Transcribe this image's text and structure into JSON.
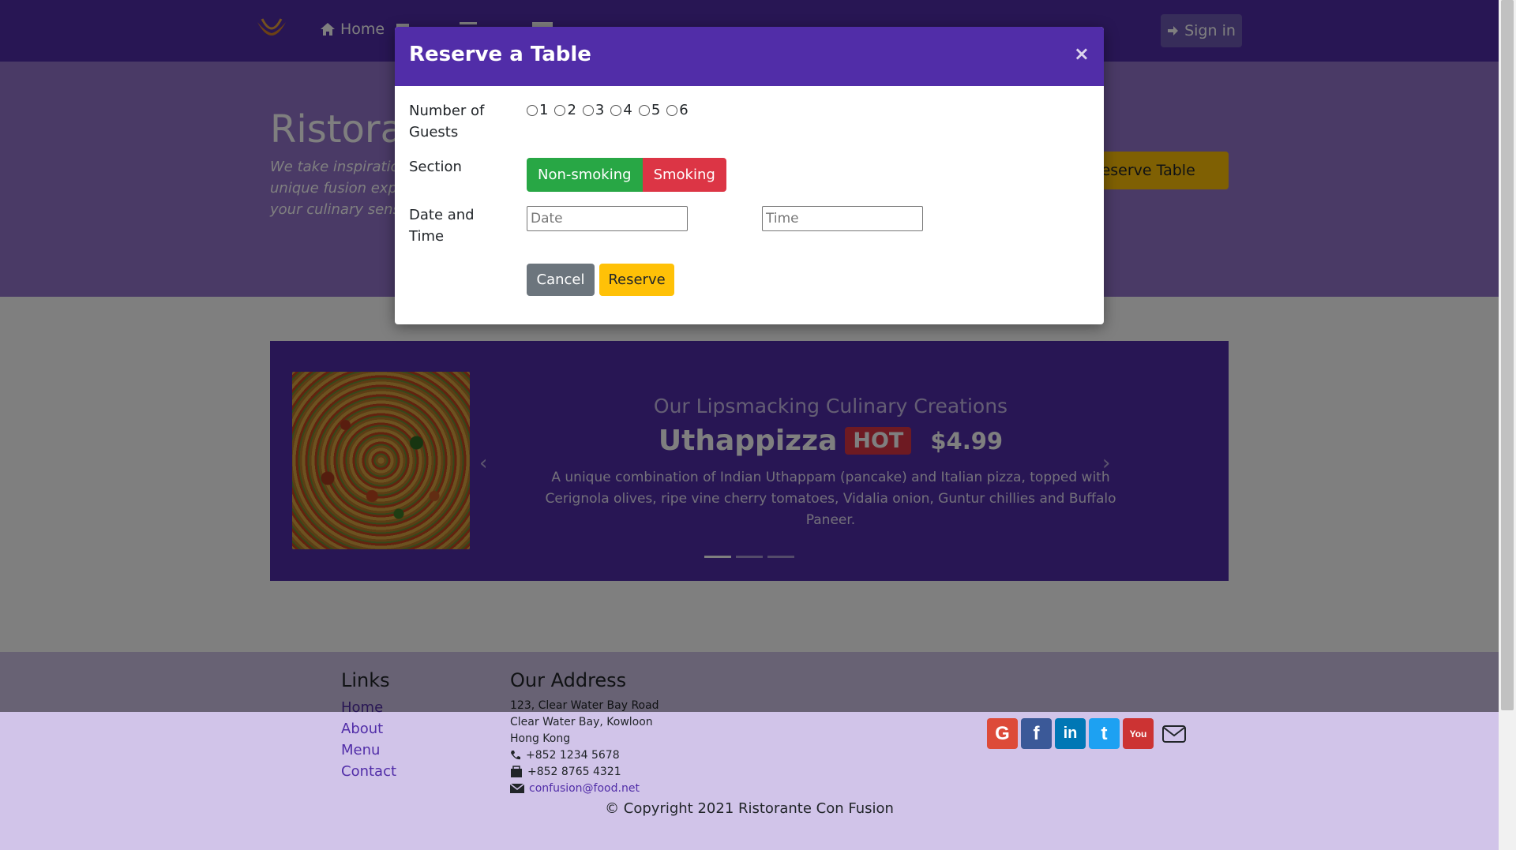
{
  "navbar": {
    "items": [
      {
        "label": "Home",
        "icon": "home-icon"
      },
      {
        "label": "",
        "icon": "info-icon"
      },
      {
        "label": "",
        "icon": "list-icon"
      },
      {
        "label": "",
        "icon": "address-card-icon"
      }
    ],
    "sign_in": "Sign in"
  },
  "jumbotron": {
    "title": "Ristorante con Fusion",
    "tagline": "We take inspiration from the World's best cuisines, and create a unique fusion experience. Our lipsmacking creations will tickle your culinary senses!",
    "reserve_button": "Reserve Table"
  },
  "carousel": {
    "subtitle": "Our Lipsmacking Culinary Creations",
    "dish_name": "Uthappizza",
    "badge": "HOT",
    "price": "$4.99",
    "description": "A unique combination of Indian Uthappam (pancake) and Italian pizza, topped with Cerignola olives, ripe vine cherry tomatoes, Vidalia onion, Guntur chillies and Buffalo Paneer.",
    "prev": "‹",
    "next": "›"
  },
  "footer": {
    "links_title": "Links",
    "links": [
      "Home",
      "About",
      "Menu",
      "Contact"
    ],
    "address_title": "Our Address",
    "address_lines": [
      "123, Clear Water Bay Road",
      "Clear Water Bay, Kowloon",
      "Hong Kong"
    ],
    "phone": "+852 1234 5678",
    "fax": "+852 8765 4321",
    "email": "confusion@food.net",
    "copyright": "© Copyright 2021 Ristorante Con Fusion",
    "social": [
      {
        "label": "G",
        "color": "#dd4b39",
        "icon": "google-plus-icon"
      },
      {
        "label": "f",
        "color": "#3b5998",
        "icon": "facebook-icon"
      },
      {
        "label": "in",
        "color": "#0077b5",
        "icon": "linkedin-icon"
      },
      {
        "label": "t",
        "color": "#1da1f2",
        "icon": "twitter-icon"
      },
      {
        "label": "You",
        "color": "#cc3333",
        "icon": "youtube-icon"
      }
    ]
  },
  "modal": {
    "title": "Reserve a Table",
    "close": "×",
    "guests_label": "Number of Guests",
    "guest_options": [
      "1",
      "2",
      "3",
      "4",
      "5",
      "6"
    ],
    "section_label": "Section",
    "section_options": [
      "Non-smoking",
      "Smoking"
    ],
    "datetime_label": "Date and Time",
    "date_placeholder": "Date",
    "time_placeholder": "Time",
    "cancel": "Cancel",
    "reserve": "Reserve"
  },
  "colors": {
    "primary": "#512da8",
    "jumbotron": "#9575cd",
    "footer": "#d1c4e9",
    "warning": "#ffc107",
    "success": "#28a745",
    "danger": "#dc3545"
  }
}
